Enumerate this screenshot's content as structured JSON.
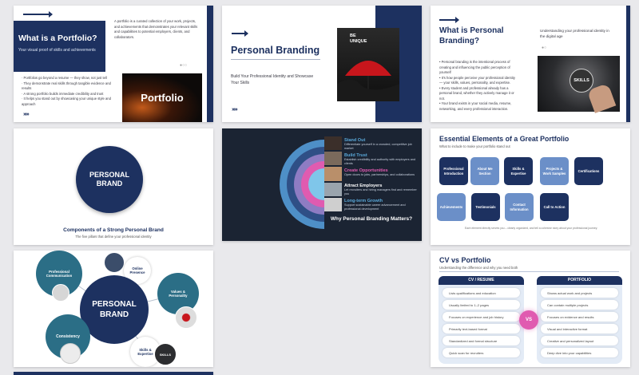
{
  "slide1": {
    "title": "What is a Portfolio?",
    "subtitle": "Your visual proof of skills and achievements",
    "intro": "A portfolio is a curated collection of your work, projects, and achievements that demonstrates your relevant skills and capabilities to potential employers, clients, and collaborators.",
    "bullets": [
      "· Portfolios go beyond a resume — they show, not just tell",
      "· They demonstrate real skills through tangible evidence and results",
      "· A strong portfolio builds immediate credibility and trust",
      "· It helps you stand out by showcasing your unique style and approach"
    ],
    "image_text": "Portfolio",
    "chevrons": "›››››"
  },
  "slide2": {
    "title": "Personal Branding",
    "subtitle": "Build Your Professional Identity and Showcase Your Skills",
    "image_text": "BE UNIQUE",
    "chevrons": "›››››"
  },
  "slide3": {
    "title": "What is Personal Branding?",
    "tagline": "Understanding your professional identity in the digital age",
    "bullets": [
      "• Personal branding is the intentional process of creating and influencing the public perception of yourself",
      "• It's how people perceive your professional identity — your skills, values, personality, and expertise.",
      "• Every student and professional already has a personal brand, whether they actively manage it or not.",
      "• Your brand exists in your social media, resume, networking, and every professional interaction."
    ],
    "image_text": "SKILLS"
  },
  "slide4": {
    "circle_text": "PERSONAL BRAND",
    "title": "Components of a Strong Personal Brand",
    "subtitle": "The five pillars that define your professional identity"
  },
  "slide5": {
    "items": [
      {
        "title": "Stand Out",
        "desc": "Differentiate yourself in a crowded, competitive job market",
        "color": "#5aa8d8"
      },
      {
        "title": "Build Trust",
        "desc": "Establish credibility and authority with employers and clients",
        "color": "#5aa8d8"
      },
      {
        "title": "Create Opportunities",
        "desc": "Open doors to jobs, partnerships, and collaborations",
        "color": "#e05bb0"
      },
      {
        "title": "Attract Employers",
        "desc": "Let recruiters and hiring managers find and remember you",
        "color": "#ffffff"
      },
      {
        "title": "Long-term Growth",
        "desc": "Support sustainable career advancement and professional development",
        "color": "#5aa8d8"
      }
    ],
    "caption": "Why Personal Branding Matters?"
  },
  "slide6": {
    "title": "Essential Elements of a Great Portfolio",
    "subtitle": "What to include to make your portfolio stand out",
    "cards": [
      {
        "label": "Professional Introduction",
        "color": "#1d3160"
      },
      {
        "label": "About Me Section",
        "color": "#6b8fc8"
      },
      {
        "label": "Skills & Expertise",
        "color": "#1d3160"
      },
      {
        "label": "Projects & Work Samples",
        "color": "#6b8fc8"
      },
      {
        "label": "Certifications",
        "color": "#1d3160"
      },
      {
        "label": "Achievements",
        "color": "#6b8fc8"
      },
      {
        "label": "Testimonials",
        "color": "#1d3160"
      },
      {
        "label": "Contact Information",
        "color": "#6b8fc8"
      },
      {
        "label": "Call to Action",
        "color": "#1d3160"
      }
    ],
    "footer": "Each element directly serves you – clearly organized, and tell a cohesive story about your professional journey."
  },
  "slide7": {
    "center": "PERSONAL BRAND",
    "nodes": [
      {
        "label": "Professional Communication"
      },
      {
        "label": "Online Presence"
      },
      {
        "label": "Values & Personality"
      },
      {
        "label": "Consistency"
      },
      {
        "label": "Skills & Expertise"
      }
    ]
  },
  "slide8": {
    "title": "CV vs Portfolio",
    "subtitle": "Understanding the difference and why you need both",
    "cv_header": "CV / RESUME",
    "portfolio_header": "PORTFOLIO",
    "vs": "VS",
    "cv_items": [
      "Lists qualifications and education",
      "Usually limited to 1–2 pages",
      "Focuses on experience and job history",
      "Primarily text-based format",
      "Standardized and formal structure",
      "Quick scan for recruiters"
    ],
    "portfolio_items": [
      "Shows actual work and projects",
      "Can contain multiple projects",
      "Focuses on evidence and results",
      "Visual and interactive format",
      "Creative and personalized layout",
      "Deep dive into your capabilities"
    ]
  },
  "colors": {
    "navy": "#1d3160",
    "teal": "#2b6e86",
    "pink": "#e05bb0",
    "dark_bg": "#1b2433"
  }
}
